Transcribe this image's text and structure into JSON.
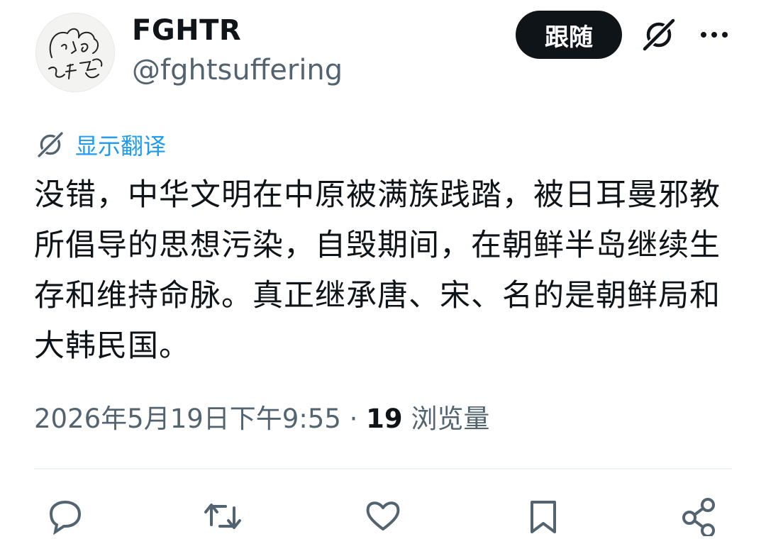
{
  "author": {
    "display_name": "FGHTR",
    "handle": "@fghtsuffering"
  },
  "header": {
    "follow_label": "跟随",
    "grok_icon": "grok-icon",
    "more_icon": "more-horizontal-icon"
  },
  "tweet": {
    "translate_label": "显示翻译",
    "text": "没错，中华文明在中原被满族践踏，被日耳曼邪教所倡导的思想污染，自毁期间，在朝鲜半岛继续生存和维持命脉。真正继承唐、宋、名的是朝鲜局和大韩民国。",
    "timestamp": "2026年5月19日下午9:55",
    "separator": "·",
    "views_count": "19",
    "views_label": "浏览量"
  },
  "actions": [
    {
      "name": "reply",
      "icon": "reply-icon"
    },
    {
      "name": "repost",
      "icon": "repost-icon"
    },
    {
      "name": "like",
      "icon": "heart-icon"
    },
    {
      "name": "bookmark",
      "icon": "bookmark-icon"
    },
    {
      "name": "share",
      "icon": "share-icon"
    }
  ],
  "colors": {
    "text": "#0f1419",
    "secondary": "#536471",
    "link": "#1d9bf0",
    "button_bg": "#0f1419"
  }
}
